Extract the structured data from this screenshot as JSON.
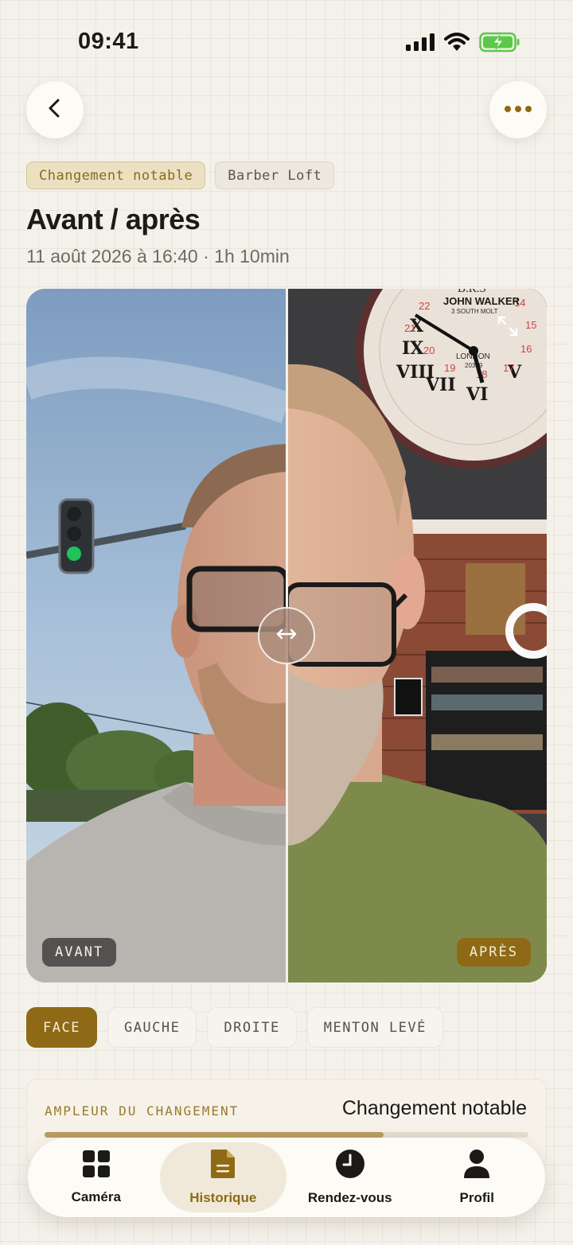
{
  "status": {
    "time": "09:41",
    "icons": [
      "signal-icon",
      "wifi-icon",
      "battery-charging-icon"
    ]
  },
  "header": {
    "back_icon": "chevron-left-icon",
    "more_icon": "ellipsis-icon"
  },
  "tags": [
    "Changement notable",
    "Barber Loft"
  ],
  "title": "Avant / après",
  "subtitle": "11 août 2026 à 16:40 · 1h 10min",
  "comparison": {
    "before_label": "AVANT",
    "after_label": "APRÈS",
    "handle_icon": "swap-horizontal-icon",
    "expand_icon": "expand-icon",
    "clock": {
      "brand": "B.R.S",
      "maker": "JOHN WALKER",
      "street": "3 SOUTH MOLT",
      "city": "LONDON",
      "code": "20389"
    }
  },
  "angles": {
    "active": 0,
    "items": [
      "FACE",
      "GAUCHE",
      "DROITE",
      "MENTON LEVÉ"
    ]
  },
  "change": {
    "label": "AMPLEUR DU CHANGEMENT",
    "value": "Changement notable",
    "progress": 0.7
  },
  "nav": {
    "active": 1,
    "items": [
      {
        "label": "Caméra",
        "icon": "grid-icon"
      },
      {
        "label": "Historique",
        "icon": "document-icon"
      },
      {
        "label": "Rendez-vous",
        "icon": "clock-icon"
      },
      {
        "label": "Profil",
        "icon": "person-icon"
      }
    ]
  },
  "colors": {
    "accent": "#8e6a16",
    "background": "#f4f1ea",
    "text": "#1c1a16"
  }
}
